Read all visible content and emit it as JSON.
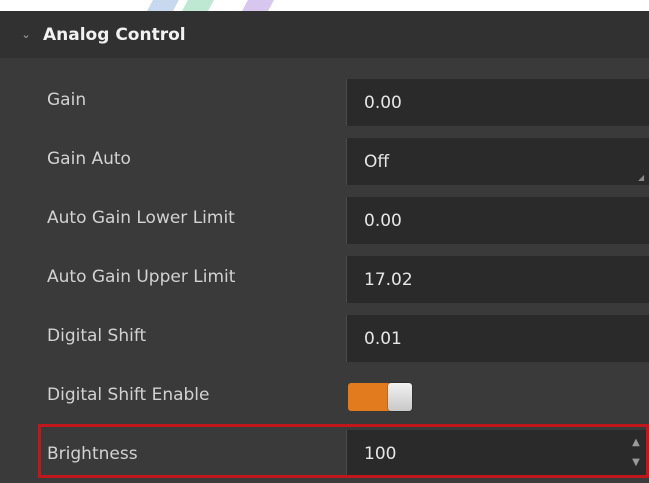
{
  "section": {
    "title": "Analog Control",
    "collapse_icon": "chevron-down-icon"
  },
  "rows": [
    {
      "label": "Gain",
      "value": "0.00",
      "type": "text"
    },
    {
      "label": "Gain Auto",
      "value": "Off",
      "type": "dropdown"
    },
    {
      "label": "Auto Gain Lower Limit",
      "value": "0.00",
      "type": "text"
    },
    {
      "label": "Auto Gain Upper Limit",
      "value": "17.02",
      "type": "text"
    },
    {
      "label": "Digital Shift",
      "value": "0.01",
      "type": "text"
    },
    {
      "label": "Digital Shift Enable",
      "value": "",
      "type": "toggle",
      "enabled": true
    },
    {
      "label": "Brightness",
      "value": "100",
      "type": "spinner"
    }
  ],
  "colors": {
    "panel_bg": "#3a3a3a",
    "field_bg": "#2a2a2a",
    "toggle_on": "#e27a1e",
    "highlight": "#c0171d"
  }
}
